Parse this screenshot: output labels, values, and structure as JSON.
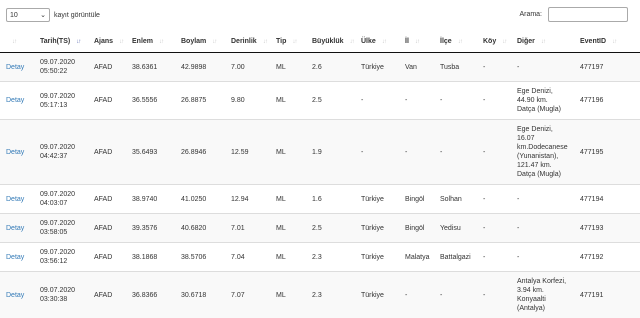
{
  "controls": {
    "length_value": "10",
    "length_label": "kayıt görüntüle",
    "search_label": "Arama:",
    "search_value": ""
  },
  "columns": [
    {
      "label": "",
      "sort": "none"
    },
    {
      "label": "Tarih(TS)",
      "sort": "desc"
    },
    {
      "label": "Ajans",
      "sort": "none"
    },
    {
      "label": "Enlem",
      "sort": "none"
    },
    {
      "label": "Boylam",
      "sort": "none"
    },
    {
      "label": "Derinlik",
      "sort": "none"
    },
    {
      "label": "Tip",
      "sort": "none"
    },
    {
      "label": "Büyüklük",
      "sort": "none"
    },
    {
      "label": "Ülke",
      "sort": "none"
    },
    {
      "label": "İl",
      "sort": "none"
    },
    {
      "label": "İlçe",
      "sort": "none"
    },
    {
      "label": "Köy",
      "sort": "none"
    },
    {
      "label": "Diğer",
      "sort": "none"
    },
    {
      "label": "EventID",
      "sort": "none"
    }
  ],
  "rows": [
    {
      "detail": "Detay",
      "date": "09.07.2020",
      "time": "05:50:22",
      "agency": "AFAD",
      "lat": "38.6361",
      "lon": "42.9898",
      "depth": "7.00",
      "type": "ML",
      "mag": "2.6",
      "country": "Türkiye",
      "province": "Van",
      "district": "Tusba",
      "village": "-",
      "other": [
        "-"
      ],
      "event_id": "477197"
    },
    {
      "detail": "Detay",
      "date": "09.07.2020",
      "time": "05:17:13",
      "agency": "AFAD",
      "lat": "36.5556",
      "lon": "26.8875",
      "depth": "9.80",
      "type": "ML",
      "mag": "2.5",
      "country": "-",
      "province": "-",
      "district": "-",
      "village": "-",
      "other": [
        "Ege Denizi,",
        "44.90 km.",
        "Datça (Mugla)"
      ],
      "event_id": "477196"
    },
    {
      "detail": "Detay",
      "date": "09.07.2020",
      "time": "04:42:37",
      "agency": "AFAD",
      "lat": "35.6493",
      "lon": "26.8946",
      "depth": "12.59",
      "type": "ML",
      "mag": "1.9",
      "country": "-",
      "province": "-",
      "district": "-",
      "village": "-",
      "other": [
        "Ege Denizi,",
        "16.07",
        "km.Dodecanese",
        "(Yunanistan),",
        "121.47 km.",
        "Datça (Mugla)"
      ],
      "event_id": "477195"
    },
    {
      "detail": "Detay",
      "date": "09.07.2020",
      "time": "04:03:07",
      "agency": "AFAD",
      "lat": "38.9740",
      "lon": "41.0250",
      "depth": "12.94",
      "type": "ML",
      "mag": "1.6",
      "country": "Türkiye",
      "province": "Bingöl",
      "district": "Solhan",
      "village": "-",
      "other": [
        "-"
      ],
      "event_id": "477194"
    },
    {
      "detail": "Detay",
      "date": "09.07.2020",
      "time": "03:58:05",
      "agency": "AFAD",
      "lat": "39.3576",
      "lon": "40.6820",
      "depth": "7.01",
      "type": "ML",
      "mag": "2.5",
      "country": "Türkiye",
      "province": "Bingöl",
      "district": "Yedisu",
      "village": "-",
      "other": [
        "-"
      ],
      "event_id": "477193"
    },
    {
      "detail": "Detay",
      "date": "09.07.2020",
      "time": "03:56:12",
      "agency": "AFAD",
      "lat": "38.1868",
      "lon": "38.5706",
      "depth": "7.04",
      "type": "ML",
      "mag": "2.3",
      "country": "Türkiye",
      "province": "Malatya",
      "district": "Battalgazi",
      "village": "-",
      "other": [
        "-"
      ],
      "event_id": "477192"
    },
    {
      "detail": "Detay",
      "date": "09.07.2020",
      "time": "03:30:38",
      "agency": "AFAD",
      "lat": "36.8366",
      "lon": "30.6718",
      "depth": "7.07",
      "type": "ML",
      "mag": "2.3",
      "country": "Türkiye",
      "province": "-",
      "district": "-",
      "village": "-",
      "other": [
        "Antalya Korfezi,",
        "3.94 km.",
        "Konyaalti",
        "(Antalya)"
      ],
      "event_id": "477191"
    }
  ]
}
